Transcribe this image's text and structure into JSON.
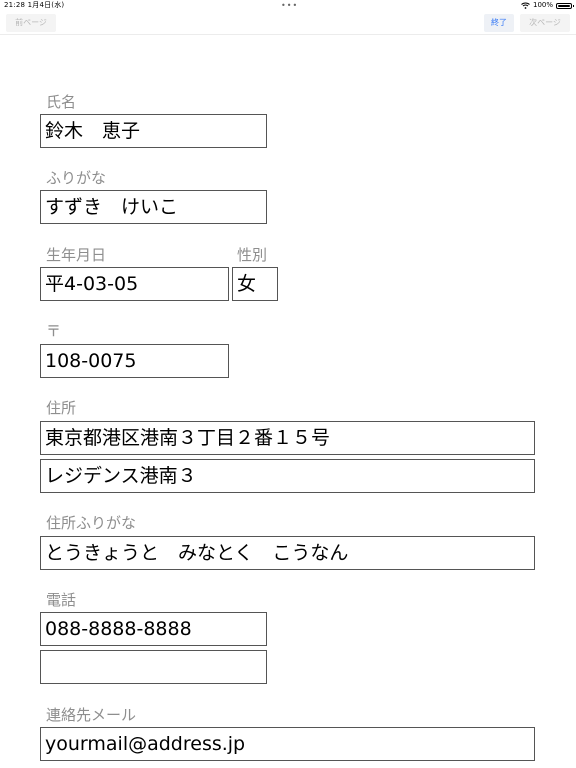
{
  "status_bar": {
    "time": "21:28   1月4日(水)",
    "dots": "•••",
    "battery": "100%"
  },
  "toolbar": {
    "prev_label": "前ページ",
    "done_label": "終了",
    "next_label": "次ページ"
  },
  "form": {
    "name_label": "氏名",
    "name_value": "鈴木　恵子",
    "furigana_label": "ふりがな",
    "furigana_value": "すずき　けいこ",
    "birth_label": "生年月日",
    "birth_value": "平4-03-05",
    "gender_label": "性別",
    "gender_value": "女",
    "postal_label": "〒",
    "postal_value": "108-0075",
    "address_label": "住所",
    "address_line1": "東京都港区港南３丁目２番１５号",
    "address_line2": "レジデンス港南３",
    "address_kana_label": "住所ふりがな",
    "address_kana_value": "とうきょうと　みなとく　こうなん",
    "phone_label": "電話",
    "phone_value1": "088-8888-8888",
    "phone_value2": "",
    "email_label": "連絡先メール",
    "email_value": "yourmail@address.jp"
  },
  "colors": {
    "label": "#8e8e8e",
    "accent": "#3478f6",
    "disabled": "#b8b8b8"
  }
}
